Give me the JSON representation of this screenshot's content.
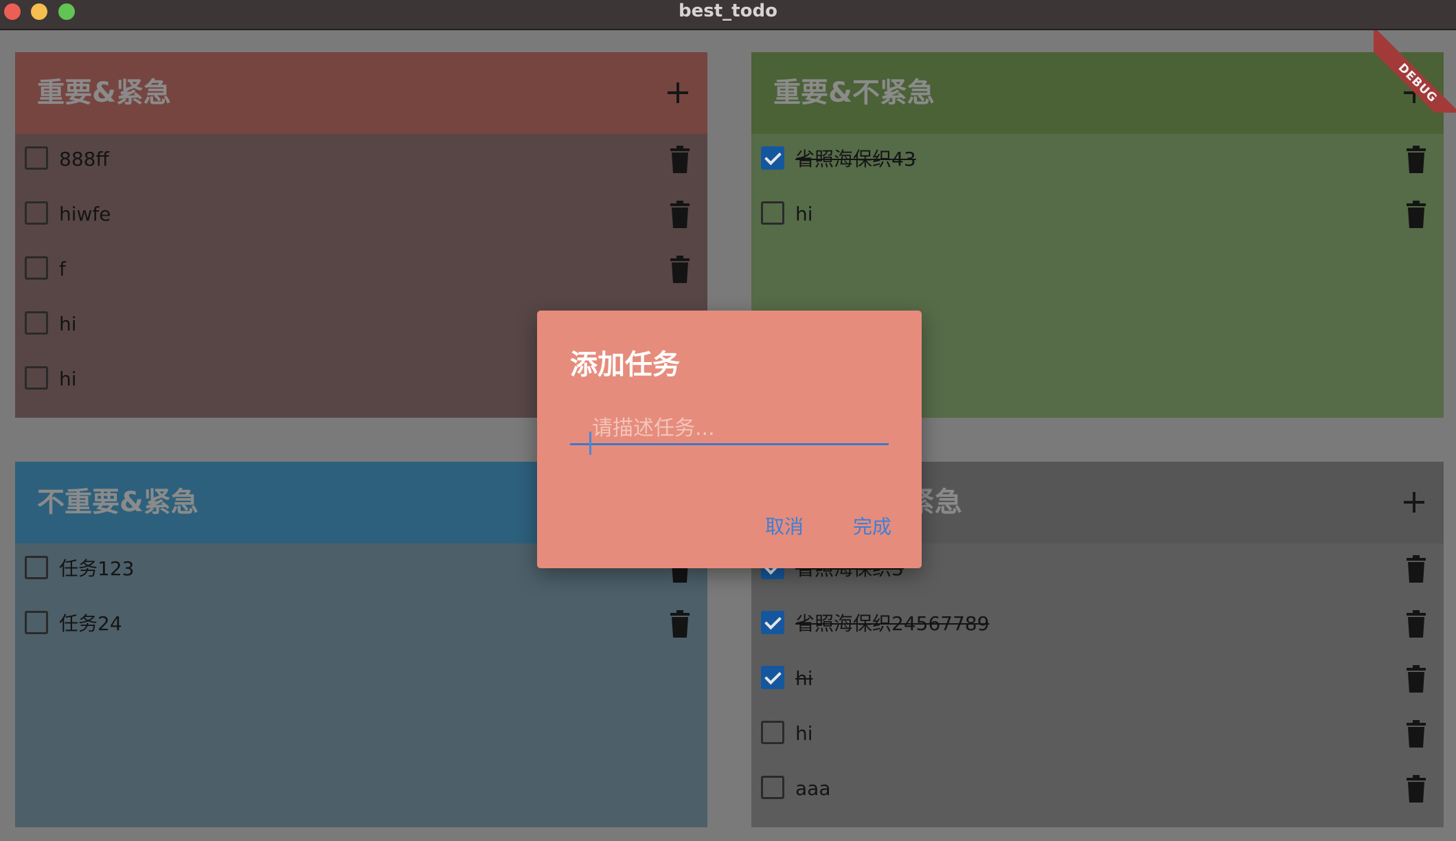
{
  "window": {
    "title": "best_todo"
  },
  "debug_banner": "DEBUG",
  "quadrants": [
    {
      "title": "重要&紧急",
      "header_color": "#764540",
      "body_color": "#584646",
      "tasks": [
        {
          "text": "888ff",
          "done": false
        },
        {
          "text": "hiwfe",
          "done": false
        },
        {
          "text": "f",
          "done": false
        },
        {
          "text": "hi",
          "done": false
        },
        {
          "text": "hi",
          "done": false
        }
      ]
    },
    {
      "title": "重要&不紧急",
      "header_color": "#4b6136",
      "body_color": "#566b48",
      "tasks": [
        {
          "text": "省照海保织43",
          "done": true
        },
        {
          "text": "hi",
          "done": false
        }
      ]
    },
    {
      "title": "不重要&紧急",
      "header_color": "#2d607c",
      "body_color": "#4d5f69",
      "tasks": [
        {
          "text": "任务123",
          "done": false
        },
        {
          "text": "任务24",
          "done": false
        }
      ]
    },
    {
      "title": "不重要&不紧急",
      "header_color": "#565656",
      "body_color": "#5c5c5c",
      "tasks": [
        {
          "text": "省照海保织3",
          "done": true
        },
        {
          "text": "省照海保织24567789",
          "done": true
        },
        {
          "text": "hi",
          "done": true
        },
        {
          "text": "hi",
          "done": false
        },
        {
          "text": "aaa",
          "done": false
        }
      ]
    }
  ],
  "dialog": {
    "title": "添加任务",
    "input_placeholder": "请描述任务...",
    "input_value": "",
    "cancel_label": "取消",
    "confirm_label": "完成",
    "background_color": "#e68c7c",
    "accent_color": "#3c7fd6"
  },
  "icons": {
    "add": "plus-icon",
    "delete": "trash-icon",
    "checkbox": "checkbox-icon"
  }
}
